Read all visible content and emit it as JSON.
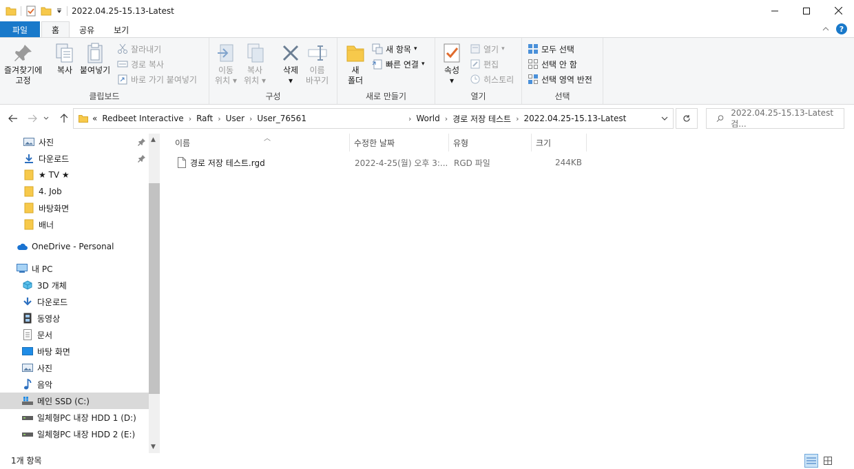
{
  "window": {
    "title": "2022.04.25-15.13-Latest"
  },
  "ribbon_tabs": [
    "파일",
    "홈",
    "공유",
    "보기"
  ],
  "ribbon": {
    "clipboard": {
      "pin_label_1": "즐겨찾기에",
      "pin_label_2": "고정",
      "copy": "복사",
      "paste": "붙여넣기",
      "cut": "잘라내기",
      "copy_path": "경로 복사",
      "paste_shortcut": "바로 가기 붙여넣기",
      "group": "클립보드"
    },
    "organize": {
      "move_1": "이동",
      "move_2": "위치",
      "copyto_1": "복사",
      "copyto_2": "위치",
      "delete": "삭제",
      "rename_1": "이름",
      "rename_2": "바꾸기",
      "group": "구성"
    },
    "new": {
      "new_folder_1": "새",
      "new_folder_2": "폴더",
      "new_item": "새 항목",
      "easy_access": "빠른 연결",
      "group": "새로 만들기"
    },
    "open": {
      "properties": "속성",
      "open": "열기",
      "edit": "편집",
      "history": "히스토리",
      "group": "열기"
    },
    "select": {
      "select_all": "모두 선택",
      "select_none": "선택 안 함",
      "invert": "선택 영역 반전",
      "group": "선택"
    }
  },
  "address": {
    "prefix": "«",
    "crumbs": [
      "Redbeet Interactive",
      "Raft",
      "User",
      "User_76561",
      "World",
      "경로 저장 테스트",
      "2022.04.25-15.13-Latest"
    ],
    "search_placeholder": "2022.04.25-15.13-Latest 검..."
  },
  "nav": {
    "quick": [
      "사진",
      "다운로드",
      "★ TV ★",
      "4. Job",
      "바탕화면",
      "배너"
    ],
    "onedrive": "OneDrive - Personal",
    "thispc": "내 PC",
    "pc_items": [
      "3D 개체",
      "다운로드",
      "동영상",
      "문서",
      "바탕 화면",
      "사진",
      "음악",
      "메인 SSD (C:)",
      "일체형PC 내장 HDD 1 (D:)",
      "일체형PC 내장 HDD 2 (E:)"
    ]
  },
  "columns": {
    "name": "이름",
    "modified": "수정한 날짜",
    "type": "유형",
    "size": "크기"
  },
  "files": [
    {
      "name": "경로 저장 테스트.rgd",
      "modified": "2022-4-25(월) 오후 3:...",
      "type": "RGD 파일",
      "size": "244KB"
    }
  ],
  "status": {
    "count": "1개 항목"
  }
}
